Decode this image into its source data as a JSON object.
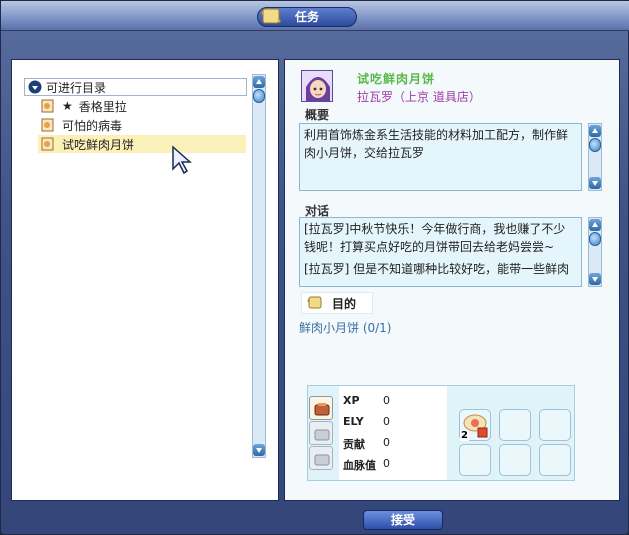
{
  "window": {
    "title": "任务"
  },
  "quest_list": {
    "root_label": "可进行目录",
    "items": [
      {
        "prefix": "★",
        "label": "香格里拉"
      },
      {
        "prefix": "",
        "label": "可怕的病毒"
      },
      {
        "prefix": "",
        "label": "试吃鲜肉月饼"
      }
    ],
    "selected_index": 2
  },
  "quest_detail": {
    "title": "试吃鲜肉月饼",
    "npc": "拉瓦罗（上京 道具店）",
    "overview_label": "概要",
    "overview_text": "利用首饰炼金系生活技能的材料加工配方，制作鲜肉小月饼，交给拉瓦罗",
    "dialog_label": "对话",
    "dialog_lines": [
      "[拉瓦罗]中秋节快乐！今年做行商，我也赚了不少钱呢！打算买点好吃的月饼带回去给老妈尝尝~",
      "[拉瓦罗] 但是不知道哪种比较好吃，能带一些鲜肉"
    ],
    "goal_label": "目的",
    "goal_item": "鲜肉小月饼  (0/1)"
  },
  "rewards": {
    "stats": [
      {
        "key": "XP",
        "value": "0"
      },
      {
        "key": "ELY",
        "value": "0"
      },
      {
        "key": "贡献",
        "value": "0"
      },
      {
        "key": "血脉值",
        "value": "0"
      }
    ],
    "item_count": "2"
  },
  "buttons": {
    "accept": "接受"
  },
  "colors": {
    "quest_title": "#57b84a",
    "npc": "#a03aa8",
    "goal_item": "#3a6ea8",
    "selected_row": "#fbf1b8"
  }
}
